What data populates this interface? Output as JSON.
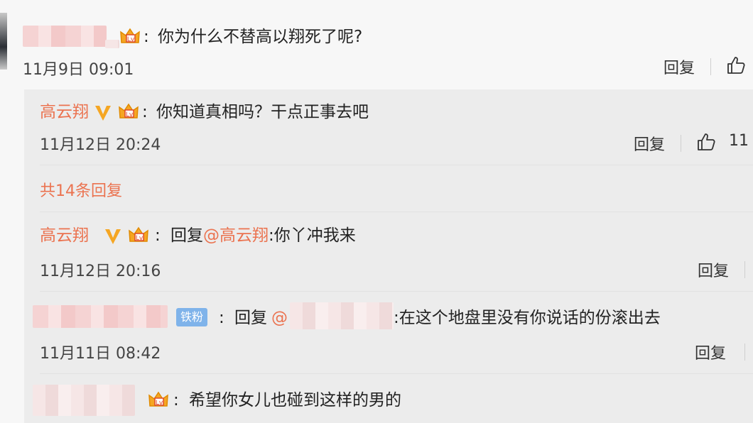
{
  "comment_main": {
    "text": "你为什么不替高以翔死了呢?",
    "time": "11月9日 09:01",
    "reply_label": "回复"
  },
  "reply_1": {
    "user": "高云翔",
    "text": "你知道真相吗？干点正事去吧",
    "time": "11月12日 20:24",
    "reply_label": "回复",
    "likes": "11"
  },
  "more_replies": "共14条回复",
  "reply_2": {
    "user": "高云翔",
    "prefix": "回复",
    "mention": "@高云翔",
    "text": ":你丫冲我来",
    "time": "11月12日 20:16",
    "reply_label": "回复"
  },
  "reply_3": {
    "fan_badge": "铁粉",
    "prefix": "回复",
    "mention": "@",
    "text": ":在这个地盘里没有你说话的份滚出去",
    "time": "11月11日 08:42",
    "reply_label": "回复"
  },
  "reply_4": {
    "text": "希望你女儿也碰到这样的男的"
  },
  "colors": {
    "accent": "#eb7350",
    "fan_badge": "#7fb3ea",
    "vip_gold": "#f5a623"
  }
}
